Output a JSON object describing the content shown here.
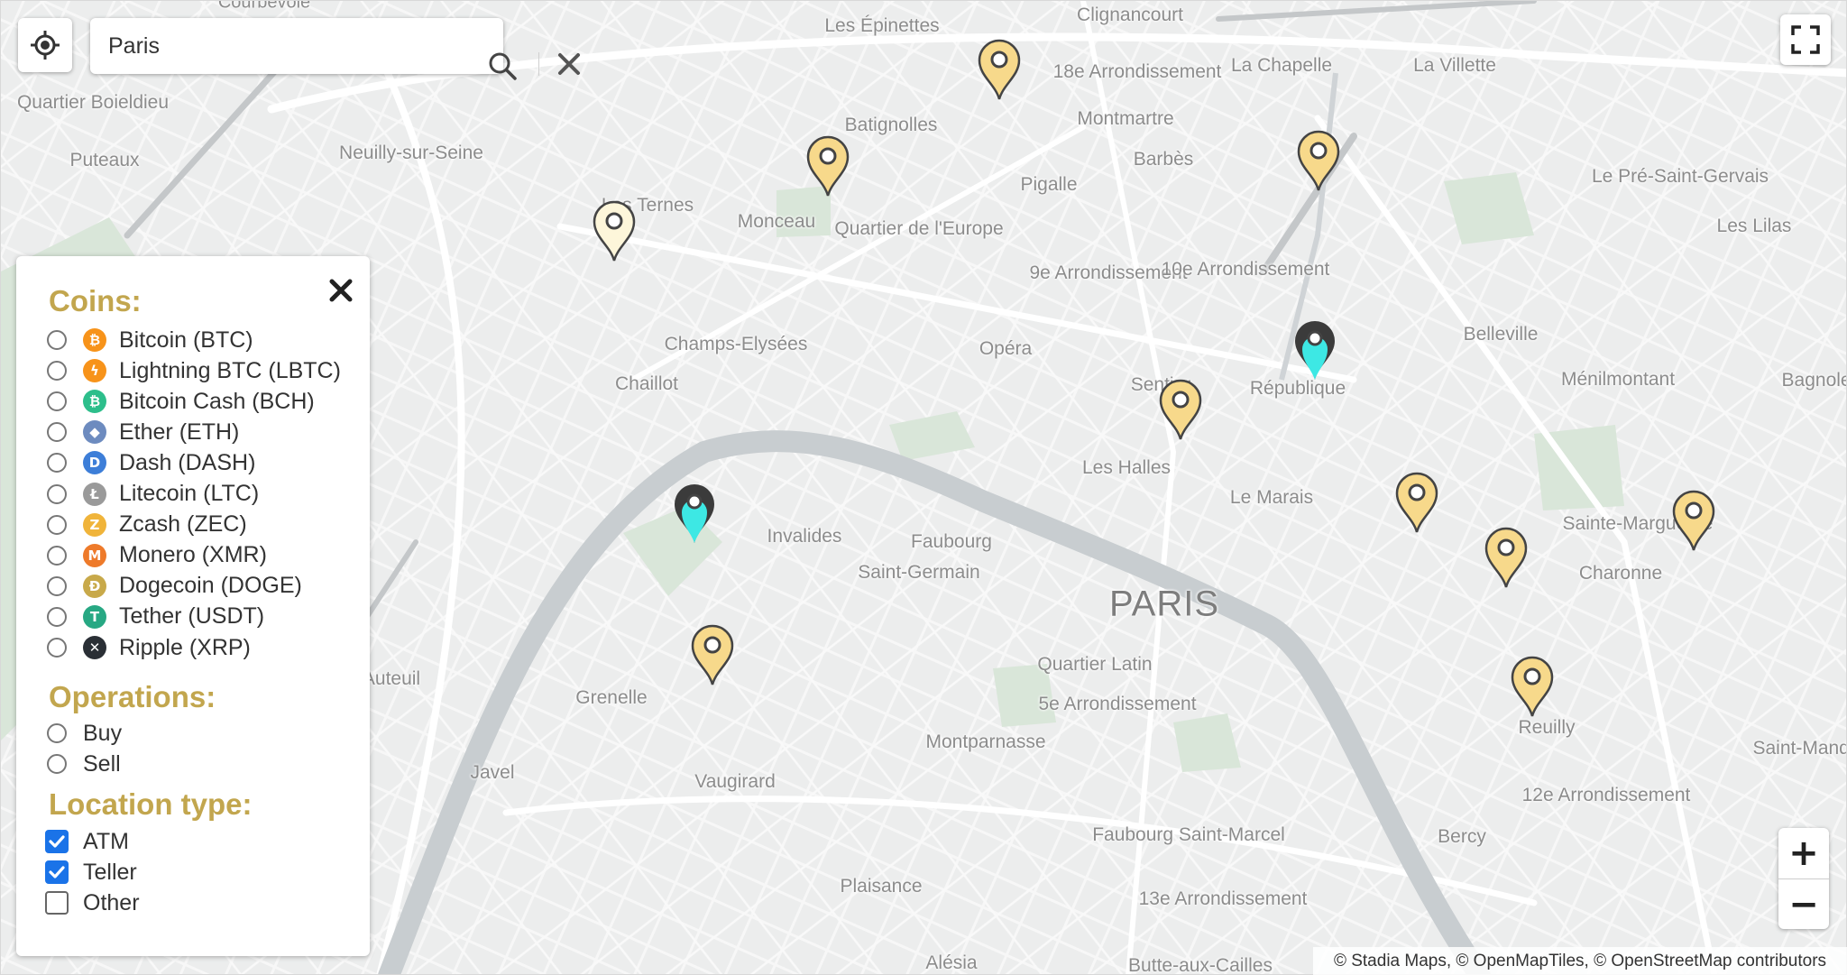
{
  "map": {
    "labels": [
      {
        "text": "Courbevoie",
        "cls": "small"
      },
      {
        "text": "Les Épinettes",
        "cls": ""
      },
      {
        "text": "Clignancourt",
        "cls": ""
      },
      {
        "text": "Quartier Boieldieu",
        "cls": ""
      },
      {
        "text": "18e Arrondissement",
        "cls": ""
      },
      {
        "text": "La Chapelle",
        "cls": ""
      },
      {
        "text": "La Villette",
        "cls": ""
      },
      {
        "text": "Batignolles",
        "cls": ""
      },
      {
        "text": "Montmartre",
        "cls": ""
      },
      {
        "text": "Puteaux",
        "cls": ""
      },
      {
        "text": "Neuilly-sur-Seine",
        "cls": ""
      },
      {
        "text": "Barbès",
        "cls": ""
      },
      {
        "text": "Pigalle",
        "cls": ""
      },
      {
        "text": "Le Pré-Saint-Gervais",
        "cls": ""
      },
      {
        "text": "Les Ternes",
        "cls": ""
      },
      {
        "text": "Monceau",
        "cls": ""
      },
      {
        "text": "Quartier de l'Europe",
        "cls": ""
      },
      {
        "text": "Les Lilas",
        "cls": ""
      },
      {
        "text": "9e Arrondissement",
        "cls": ""
      },
      {
        "text": "10e Arrondissement",
        "cls": ""
      },
      {
        "text": "Belleville",
        "cls": ""
      },
      {
        "text": "Champs-Elysées",
        "cls": ""
      },
      {
        "text": "Opéra",
        "cls": ""
      },
      {
        "text": "Chaillot",
        "cls": ""
      },
      {
        "text": "Sentier",
        "cls": ""
      },
      {
        "text": "République",
        "cls": ""
      },
      {
        "text": "Ménilmontant",
        "cls": ""
      },
      {
        "text": "Bagnolet",
        "cls": ""
      },
      {
        "text": "Les Halles",
        "cls": ""
      },
      {
        "text": "Le Marais",
        "cls": ""
      },
      {
        "text": "Invalides",
        "cls": ""
      },
      {
        "text": "Faubourg",
        "cls": ""
      },
      {
        "text": "Saint-Germain",
        "cls": ""
      },
      {
        "text": "Sainte-Marguerite",
        "cls": ""
      },
      {
        "text": "Charonne",
        "cls": ""
      },
      {
        "text": "PARIS",
        "cls": "big"
      },
      {
        "text": "Auteuil",
        "cls": ""
      },
      {
        "text": "Quartier Latin",
        "cls": ""
      },
      {
        "text": "Grenelle",
        "cls": ""
      },
      {
        "text": "5e Arrondissement",
        "cls": ""
      },
      {
        "text": "Reuilly",
        "cls": ""
      },
      {
        "text": "Montparnasse",
        "cls": ""
      },
      {
        "text": "Saint-Mandé",
        "cls": ""
      },
      {
        "text": "Javel",
        "cls": ""
      },
      {
        "text": "Vaugirard",
        "cls": ""
      },
      {
        "text": "12e Arrondissement",
        "cls": ""
      },
      {
        "text": "Faubourg Saint-Marcel",
        "cls": ""
      },
      {
        "text": "Bercy",
        "cls": ""
      },
      {
        "text": "Plaisance",
        "cls": ""
      },
      {
        "text": "13e Arrondissement",
        "cls": ""
      },
      {
        "text": "Alésia",
        "cls": ""
      },
      {
        "text": "Butte-aux-Cailles",
        "cls": ""
      }
    ],
    "markers": [
      {
        "type": "yellow"
      },
      {
        "type": "yellow"
      },
      {
        "type": "pale"
      },
      {
        "type": "yellow"
      },
      {
        "type": "teal"
      },
      {
        "type": "yellow"
      },
      {
        "type": "teal"
      },
      {
        "type": "yellow"
      },
      {
        "type": "yellow"
      },
      {
        "type": "yellow"
      },
      {
        "type": "yellow"
      },
      {
        "type": "yellow"
      }
    ],
    "marker_colors": {
      "yellow": "#f7d98b",
      "pale": "#fdf6da",
      "teal": "#3de8e4",
      "outline": "#444444",
      "dark": "#3b3b3b"
    }
  },
  "search": {
    "value": "Paris",
    "search_icon": "search-icon",
    "clear_icon": "close-icon"
  },
  "controls": {
    "locate_icon": "crosshair-icon",
    "fullscreen_icon": "fullscreen-icon",
    "zoom_in": "+",
    "zoom_out": "−"
  },
  "attribution": "© Stadia Maps, © OpenMapTiles, © OpenStreetMap contributors",
  "filters": {
    "close_icon": "close-icon",
    "title_color": "#c2a64e",
    "coins_title": "Coins:",
    "coins": [
      {
        "label": "Bitcoin (BTC)",
        "icon": "bitcoin-icon",
        "glyph": "₿",
        "color": "#f7931a"
      },
      {
        "label": "Lightning BTC (LBTC)",
        "icon": "lightning-icon",
        "glyph": "ϟ",
        "color": "#f7931a"
      },
      {
        "label": "Bitcoin Cash (BCH)",
        "icon": "bitcoin-cash-icon",
        "glyph": "₿",
        "color": "#2dbe8b"
      },
      {
        "label": "Ether (ETH)",
        "icon": "ether-icon",
        "glyph": "◆",
        "color": "#6d8bbf"
      },
      {
        "label": "Dash (DASH)",
        "icon": "dash-icon",
        "glyph": "D",
        "color": "#3d7ed8"
      },
      {
        "label": "Litecoin (LTC)",
        "icon": "litecoin-icon",
        "glyph": "Ł",
        "color": "#9a9a9a"
      },
      {
        "label": "Zcash (ZEC)",
        "icon": "zcash-icon",
        "glyph": "Z",
        "color": "#f0b43a"
      },
      {
        "label": "Monero (XMR)",
        "icon": "monero-icon",
        "glyph": "M",
        "color": "#ee7a2a"
      },
      {
        "label": "Dogecoin (DOGE)",
        "icon": "dogecoin-icon",
        "glyph": "Ð",
        "color": "#c8a94a"
      },
      {
        "label": "Tether (USDT)",
        "icon": "tether-icon",
        "glyph": "T",
        "color": "#27a883"
      },
      {
        "label": "Ripple (XRP)",
        "icon": "ripple-icon",
        "glyph": "✕",
        "color": "#2a2f35"
      }
    ],
    "operations_title": "Operations:",
    "operations": [
      {
        "label": "Buy"
      },
      {
        "label": "Sell"
      }
    ],
    "location_title": "Location type:",
    "locations": [
      {
        "label": "ATM",
        "checked": true
      },
      {
        "label": "Teller",
        "checked": true
      },
      {
        "label": "Other",
        "checked": false
      }
    ],
    "check_color": "#1a73e8"
  }
}
